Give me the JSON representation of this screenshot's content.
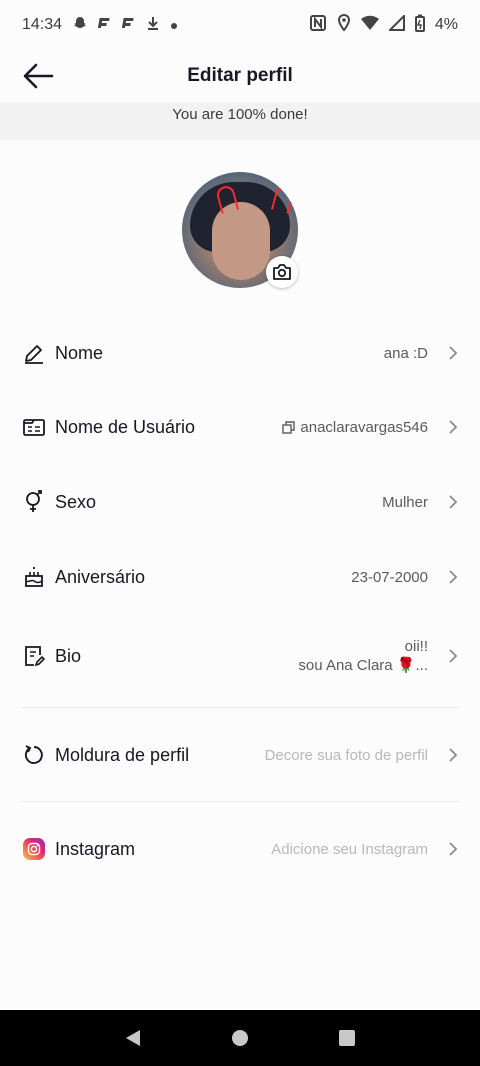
{
  "status_bar": {
    "time": "14:34",
    "notification_icons": [
      "snapchat-icon",
      "flipboard-icon",
      "flipboard-icon",
      "download-icon",
      "dot-icon"
    ],
    "battery": "4%",
    "right_icons": [
      "nfc-icon",
      "location-icon",
      "wifi-icon",
      "signal-icon",
      "battery-icon"
    ]
  },
  "header": {
    "title": "Editar perfil"
  },
  "banner": {
    "text": "You are 100% done!"
  },
  "fields": [
    {
      "label": "Nome",
      "value": "ana :D",
      "icon": "pencil-icon"
    },
    {
      "label": "Nome de Usuário",
      "value": "anaclaravargas546",
      "icon": "id-card-icon"
    },
    {
      "label": "Sexo",
      "value": "Mulher",
      "icon": "gender-icon"
    },
    {
      "label": "Aniversário",
      "value": "23-07-2000",
      "icon": "cake-icon"
    },
    {
      "label": "Bio",
      "value_line1": "oii!!",
      "value_line2": "sou Ana Clara 🌹...",
      "icon": "note-icon"
    },
    {
      "label": "Moldura de perfil",
      "value": "Decore sua foto de perfil",
      "icon": "refresh-icon"
    },
    {
      "label": "Instagram",
      "value": "Adicione seu Instagram",
      "icon": "instagram-icon"
    }
  ],
  "colors": {
    "text": "#161823",
    "muted": "#5a5a5a",
    "placeholder": "#b7b7bc",
    "banner_bg": "#f2f2f2",
    "nav_bg": "#000000"
  },
  "nav": [
    "back-triangle-icon",
    "home-circle-icon",
    "recents-square-icon"
  ]
}
